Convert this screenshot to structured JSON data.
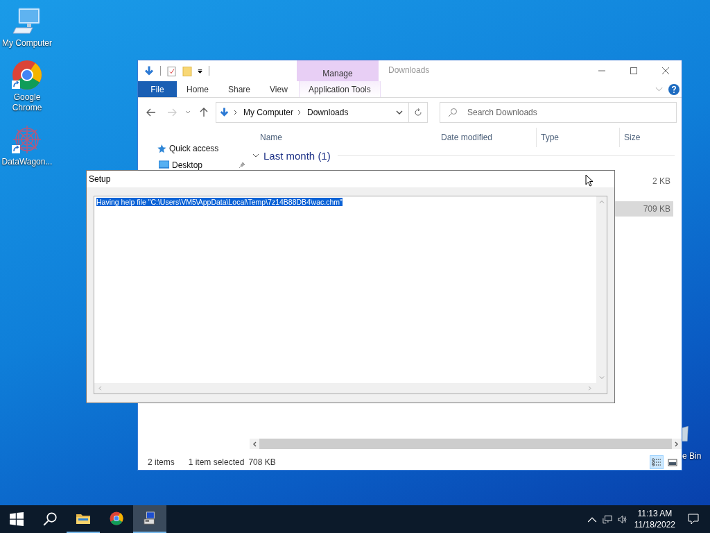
{
  "desktop_icons": [
    {
      "label": "My Computer",
      "kind": "computer",
      "shortcut": false
    },
    {
      "label": "Google Chrome",
      "kind": "chrome",
      "shortcut": true
    },
    {
      "label": "DataWagon...",
      "kind": "app",
      "shortcut": true
    }
  ],
  "recycle_bin": {
    "label": "e Bin"
  },
  "explorer": {
    "title": "Downloads",
    "contextual_tab": "Manage",
    "ribbon_tabs": [
      {
        "label": "File",
        "kind": "file",
        "selected": false
      },
      {
        "label": "Home",
        "kind": "tab",
        "selected": false
      },
      {
        "label": "Share",
        "kind": "tab",
        "selected": false
      },
      {
        "label": "View",
        "kind": "tab",
        "selected": false
      },
      {
        "label": "Application Tools",
        "kind": "contextual",
        "selected": false
      }
    ],
    "breadcrumb": [
      "My Computer",
      "Downloads"
    ],
    "search": {
      "placeholder": "Search Downloads"
    },
    "columns": [
      "Name",
      "Date modified",
      "Type",
      "Size"
    ],
    "nav": [
      {
        "label": "Quick access",
        "kind": "star",
        "pinned": false
      },
      {
        "label": "Desktop",
        "kind": "desktop",
        "pinned": true
      }
    ],
    "group": "Last month (1)",
    "rows": [
      {
        "size": "2 KB",
        "selected": false
      },
      {
        "size": "709 KB",
        "selected": true
      }
    ],
    "status": [
      "2 items",
      "1 item selected",
      "708 KB"
    ],
    "views": [
      {
        "kind": "details",
        "selected": true
      },
      {
        "kind": "thumbnails",
        "selected": false
      }
    ]
  },
  "setup": {
    "title": "Setup",
    "lines": [
      {
        "text": "Having help file \"C:\\Users\\VM5\\AppData\\Local\\Temp\\7z14B88DB4\\vac.chm\"",
        "selected": true
      }
    ]
  },
  "taskbar": {
    "apps": [
      {
        "kind": "explorer",
        "running": true,
        "selected": false
      },
      {
        "kind": "chrome",
        "running": false,
        "selected": false
      },
      {
        "kind": "setup",
        "running": true,
        "selected": true
      }
    ],
    "time": "11:13 AM",
    "date": "11/18/2022"
  }
}
